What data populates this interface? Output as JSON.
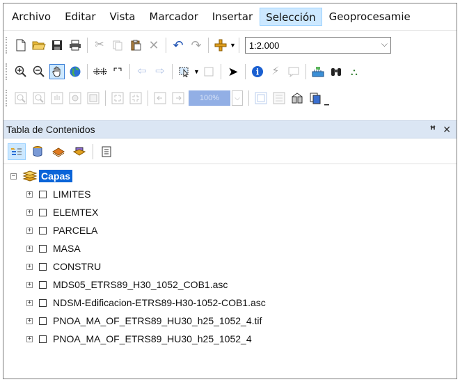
{
  "menu": {
    "items": [
      "Archivo",
      "Editar",
      "Vista",
      "Marcador",
      "Insertar",
      "Selección",
      "Geoprocesamie"
    ],
    "active": "Selección"
  },
  "toolbar": {
    "scale_value": "1:2.000",
    "zoom_percent": "100%"
  },
  "toc": {
    "title": "Tabla de Contenidos",
    "pin_icon": "pin-icon",
    "close_icon": "close-icon",
    "root_label": "Capas",
    "layers": [
      "LIMITES",
      "ELEMTEX",
      "PARCELA",
      "MASA",
      "CONSTRU",
      "MDS05_ETRS89_H30_1052_COB1.asc",
      "NDSM-Edificacion-ETRS89-H30-1052-COB1.asc",
      "PNOA_MA_OF_ETRS89_HU30_h25_1052_4.tif",
      "PNOA_MA_OF_ETRS89_HU30_h25_1052_4"
    ]
  },
  "colors": {
    "selection_highlight": "#0a64d8",
    "title_bar": "#dbe6f4",
    "active_menu": "#cce8ff"
  }
}
